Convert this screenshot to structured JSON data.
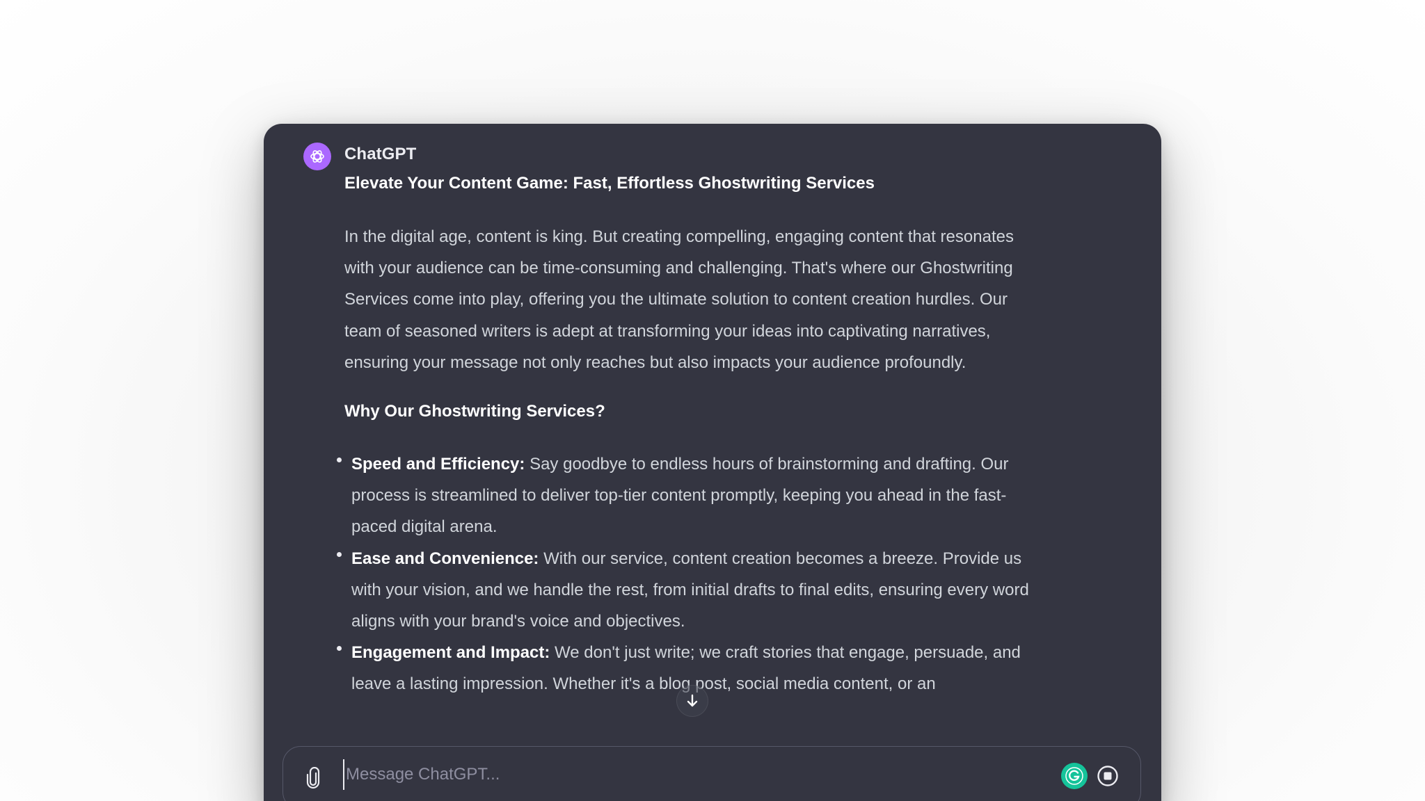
{
  "chat": {
    "sender": "ChatGPT",
    "title": "Elevate Your Content Game: Fast, Effortless Ghostwriting Services",
    "intro": "In the digital age, content is king. But creating compelling, engaging content that resonates with your audience can be time-consuming and challenging. That's where our Ghostwriting Services come into play, offering you the ultimate solution to content creation hurdles. Our team of seasoned writers is adept at transforming your ideas into captivating narratives, ensuring your message not only reaches but also impacts your audience profoundly.",
    "subheading": "Why Our Ghostwriting Services?",
    "bullets": [
      {
        "label": "Speed and Efficiency:",
        "text": "Say goodbye to endless hours of brainstorming and drafting. Our process is streamlined to deliver top-tier content promptly, keeping you ahead in the fast-paced digital arena."
      },
      {
        "label": "Ease and Convenience:",
        "text": "With our service, content creation becomes a breeze. Provide us with your vision, and we handle the rest, from initial drafts to final edits, ensuring every word aligns with your brand's voice and objectives."
      },
      {
        "label": "Engagement and Impact:",
        "text": "We don't just write; we craft stories that engage, persuade, and leave a lasting impression. Whether it's a blog post, social media content, or an"
      }
    ]
  },
  "composer": {
    "placeholder": "Message ChatGPT...",
    "value": ""
  },
  "icons": {
    "avatar": "openai-logo-icon",
    "scroll": "arrow-down-icon",
    "attach": "paperclip-icon",
    "grammarly": "grammarly-icon",
    "stop": "stop-generating-icon"
  },
  "colors": {
    "window_bg": "#343541",
    "avatar_bg": "#ab68ff",
    "grammarly": "#15c39a",
    "text_primary": "#ececf1",
    "text_body": "#d1d5db",
    "placeholder": "#8e8ea0"
  }
}
